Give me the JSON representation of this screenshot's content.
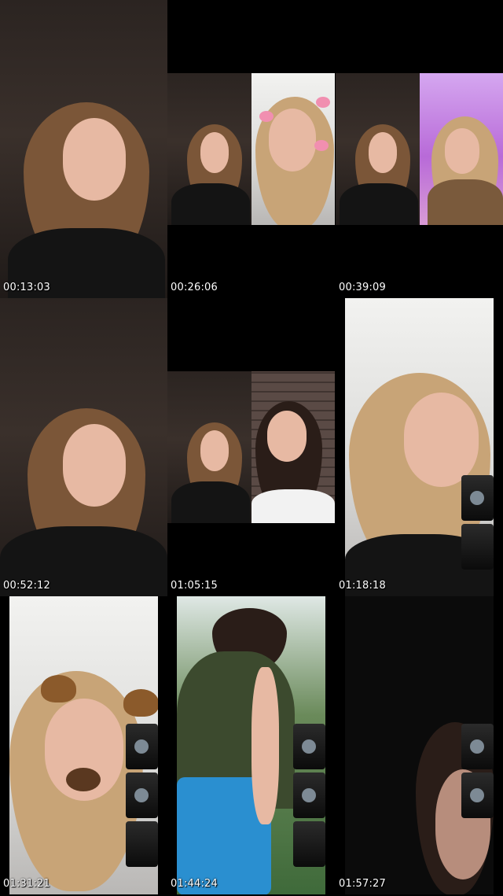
{
  "timestamps": [
    "00:13:03",
    "00:26:06",
    "00:39:09",
    "00:52:12",
    "01:05:15",
    "01:18:18",
    "01:31:21",
    "01:44:24",
    "01:57:27"
  ]
}
